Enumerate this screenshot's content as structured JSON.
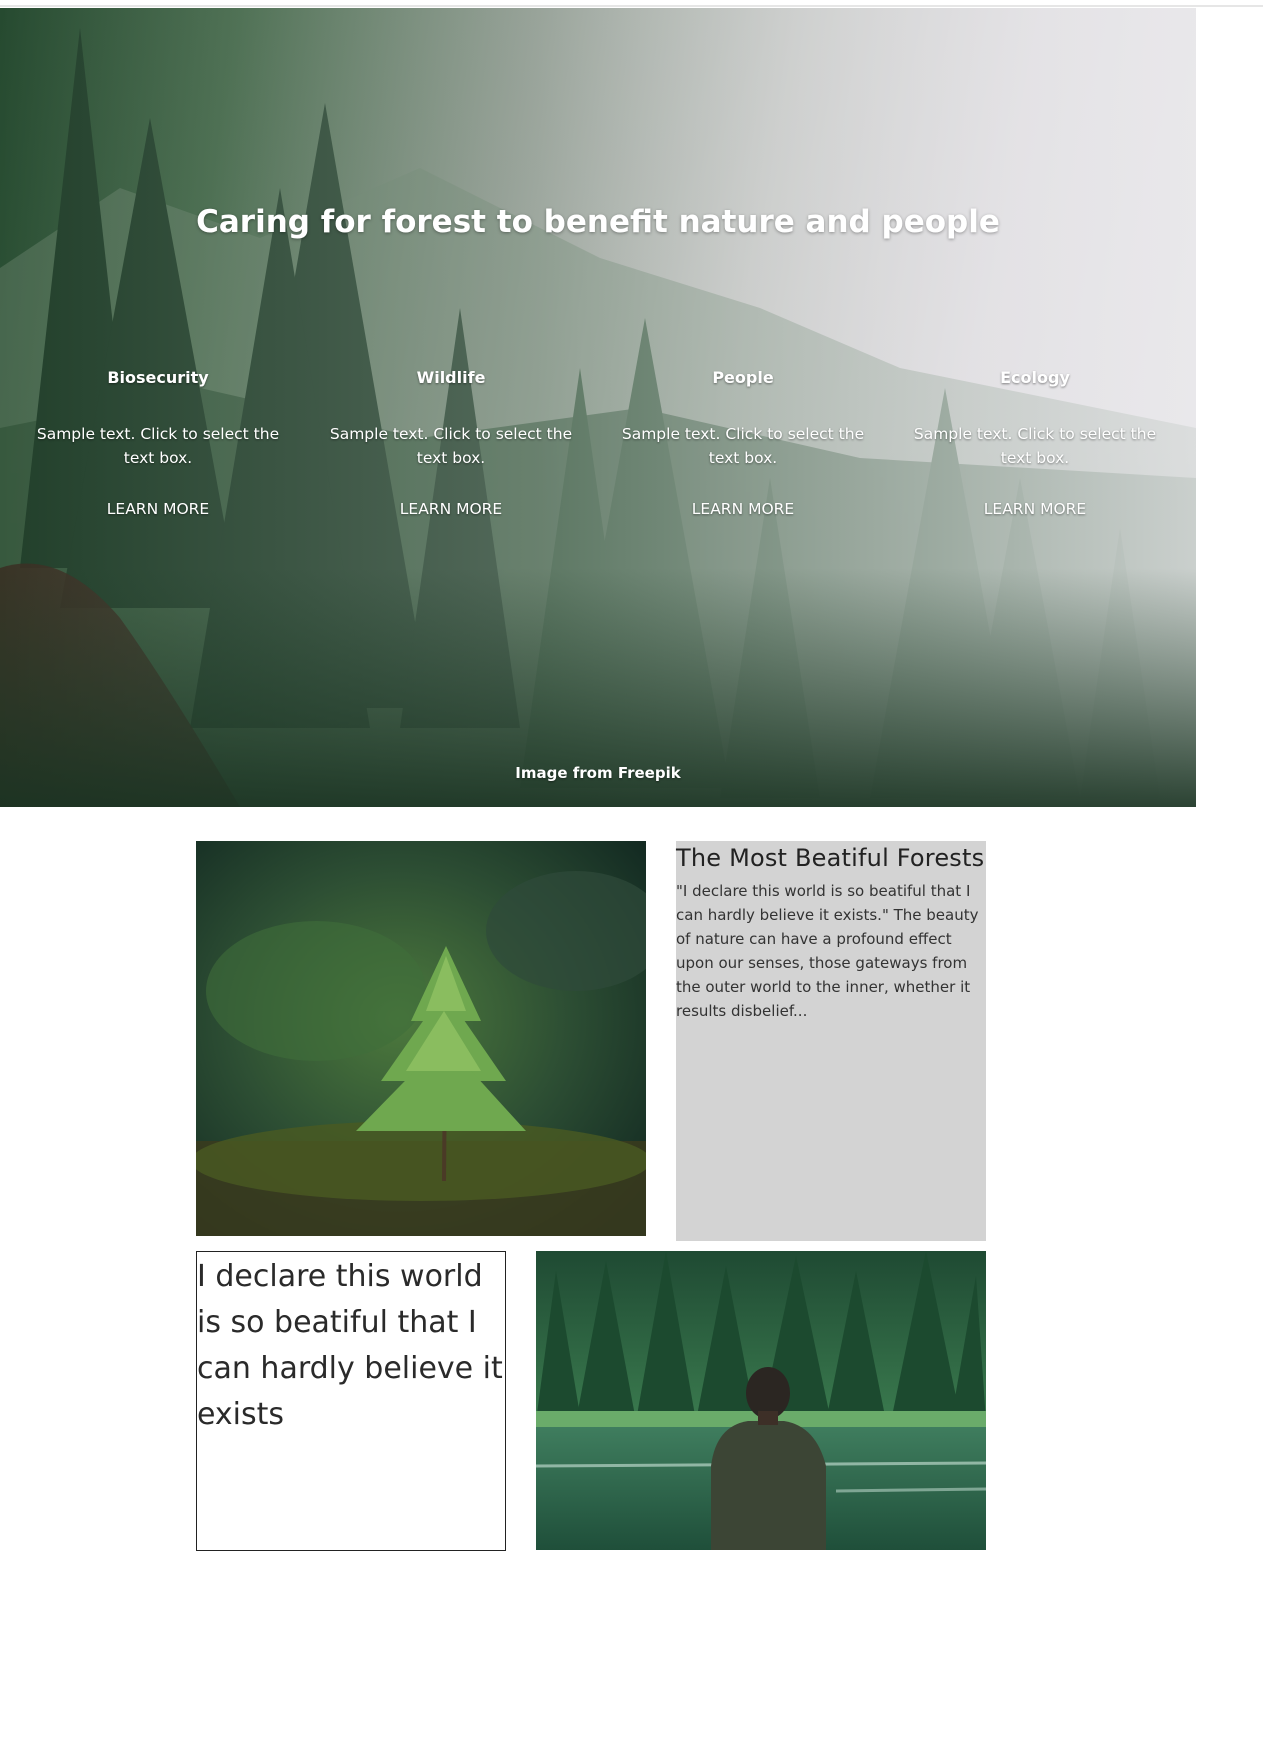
{
  "hero": {
    "title": "Caring for forest to benefit nature and people",
    "features": [
      {
        "title": "Biosecurity",
        "text": "Sample text. Click to select the text box.",
        "link": "LEARN MORE"
      },
      {
        "title": "Wildlife",
        "text": "Sample text. Click to select the text box.",
        "link": "LEARN MORE"
      },
      {
        "title": "People",
        "text": "Sample text. Click to select the text box.",
        "link": "LEARN MORE"
      },
      {
        "title": "Ecology",
        "text": "Sample text. Click to select the text box.",
        "link": "LEARN MORE"
      }
    ],
    "credit": "Image from Freepik"
  },
  "article": {
    "title": "The Most Beatiful Forests",
    "body": "\"I declare this world is so beatiful that I can hardly believe it exists.\" The beauty of nature can have a profound effect upon our senses, those gateways from the outer world to the inner, whether it results disbelief..."
  },
  "quote": {
    "text": "I declare this world is so beatiful that I can hardly believe it exists"
  },
  "colors": {
    "forest_dark": "#1f3d2a",
    "fog": "#dedce0",
    "card_bg": "#d3d3d3"
  }
}
